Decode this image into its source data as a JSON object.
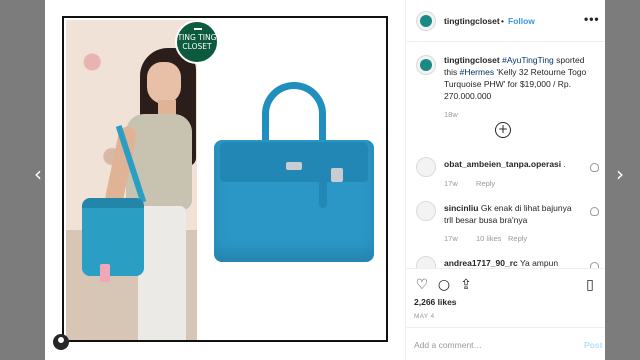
{
  "nav": {
    "prev": "‹",
    "next": "›"
  },
  "post": {
    "stamp_line1": "TING TING",
    "stamp_line2": "CLOSET"
  },
  "header": {
    "username": "tingtingcloset",
    "separator": "•",
    "follow_label": "Follow",
    "more_label": "•••"
  },
  "caption": {
    "username": "tingtingcloset",
    "mention": "#AyuTingTing",
    "text1": " sported this ",
    "hashtag": "#Hermes",
    "text2": " 'Kelly 32 Retourne Togo Turquoise PHW' for $19,000 / Rp. 270.000.000",
    "age": "18w",
    "load_more": "+"
  },
  "comments": [
    {
      "username": "obat_ambeien_tanpa.operasi",
      "text": ".",
      "age": "17w",
      "likes": "",
      "reply": "Reply"
    },
    {
      "username": "sincinliu",
      "text": "Gk enak di lihat bajunya trll besar busa bra'nya",
      "age": "17w",
      "likes": "10 likes",
      "reply": "Reply"
    },
    {
      "username": "andrea1717_90_rc",
      "text": "Ya ampun",
      "age": "",
      "likes": "",
      "reply": ""
    }
  ],
  "actions": {
    "like_icon": "♡",
    "comment_icon": "○",
    "share_icon": "⇪",
    "save_icon": "▯",
    "likes": "2,266 likes",
    "date": "MAY 4"
  },
  "add_comment": {
    "placeholder": "Add a comment…",
    "post_label": "Post"
  },
  "colors": {
    "link": "#3897f0",
    "bag": "#2b97c6",
    "stamp": "#0c5b3f"
  }
}
